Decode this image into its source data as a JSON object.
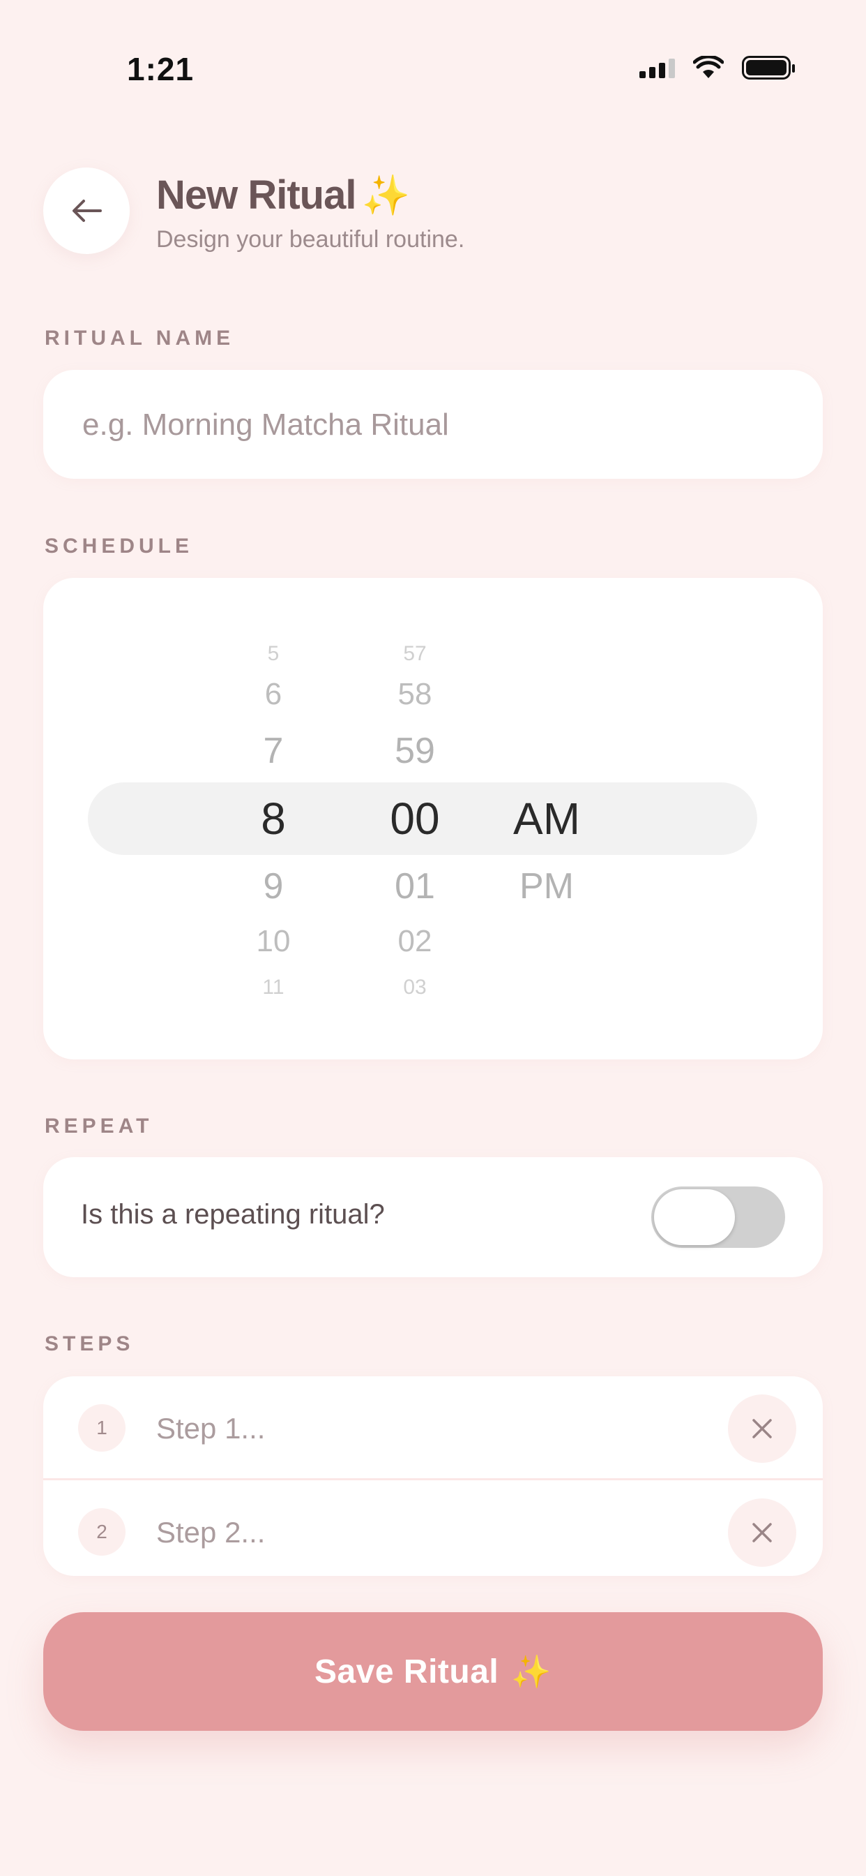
{
  "status_bar": {
    "time": "1:21",
    "icons": [
      "signal-icon",
      "wifi-icon",
      "battery-icon"
    ]
  },
  "header": {
    "back_icon": "arrow-left-icon",
    "title": "New Ritual",
    "title_emoji": "✨",
    "subtitle": "Design your beautiful routine."
  },
  "ritual_name": {
    "label": "RITUAL NAME",
    "value": "",
    "placeholder": "e.g. Morning Matcha Ritual"
  },
  "schedule": {
    "label": "SCHEDULE",
    "selected": {
      "hour": "8",
      "minute": "00",
      "period": "AM"
    },
    "hours": {
      "above": [
        "5",
        "6",
        "7"
      ],
      "below": [
        "9",
        "10",
        "11"
      ]
    },
    "minutes": {
      "above": [
        "57",
        "58",
        "59"
      ],
      "below": [
        "01",
        "02",
        "03"
      ]
    },
    "periods": {
      "below": [
        "PM"
      ]
    }
  },
  "repeat": {
    "label": "REPEAT",
    "question": "Is this a repeating ritual?",
    "enabled": false
  },
  "steps": {
    "label": "STEPS",
    "items": [
      {
        "number": "1",
        "value": "",
        "placeholder": "Step 1..."
      },
      {
        "number": "2",
        "value": "",
        "placeholder": "Step 2..."
      }
    ],
    "remove_icon": "close-icon"
  },
  "save": {
    "label": "Save Ritual",
    "emoji": "✨"
  },
  "colors": {
    "background": "#fdf1f0",
    "card": "#ffffff",
    "accent": "#e39a9c",
    "label": "#9e8587",
    "sparkle": "#f3c44a"
  }
}
